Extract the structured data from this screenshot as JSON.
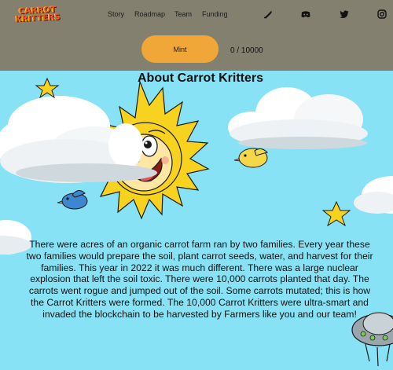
{
  "header": {
    "logo_text": "CARROT KRITTERS",
    "nav": [
      {
        "label": "Story"
      },
      {
        "label": "Roadmap"
      },
      {
        "label": "Team"
      },
      {
        "label": "Funding"
      }
    ],
    "social_icons": [
      "pen-icon",
      "discord-icon",
      "twitter-icon",
      "instagram-icon"
    ]
  },
  "mint": {
    "button_label": "Mint",
    "counter": "0 / 10000"
  },
  "about": {
    "title": "About Carrot Kritters",
    "story": "There were acres of an organic carrot farm ran by two families. Every year these two families would prepare the soil, plant carrot seeds, water, and harvest for their families. This year in 2022 it was much different. There was a large nuclear explosion that left the soil toxic. There were 10,000 carrots planted that day. The carrots went rogue and jumped out of the soil. Some carrots mutated; this is how the Carrot Kritters were formed. The 10,000 Carrot Kritters were ultra-smart and invaded the blockchain to be harvested by Farmers like you and our team!"
  },
  "colors": {
    "header_bg": "#84806f",
    "sky": "#86e2f4",
    "mint_button": "#f1a638",
    "sun": "#f7d21e",
    "bird_yellow": "#f5d84a",
    "bird_blue": "#3d86d0"
  }
}
